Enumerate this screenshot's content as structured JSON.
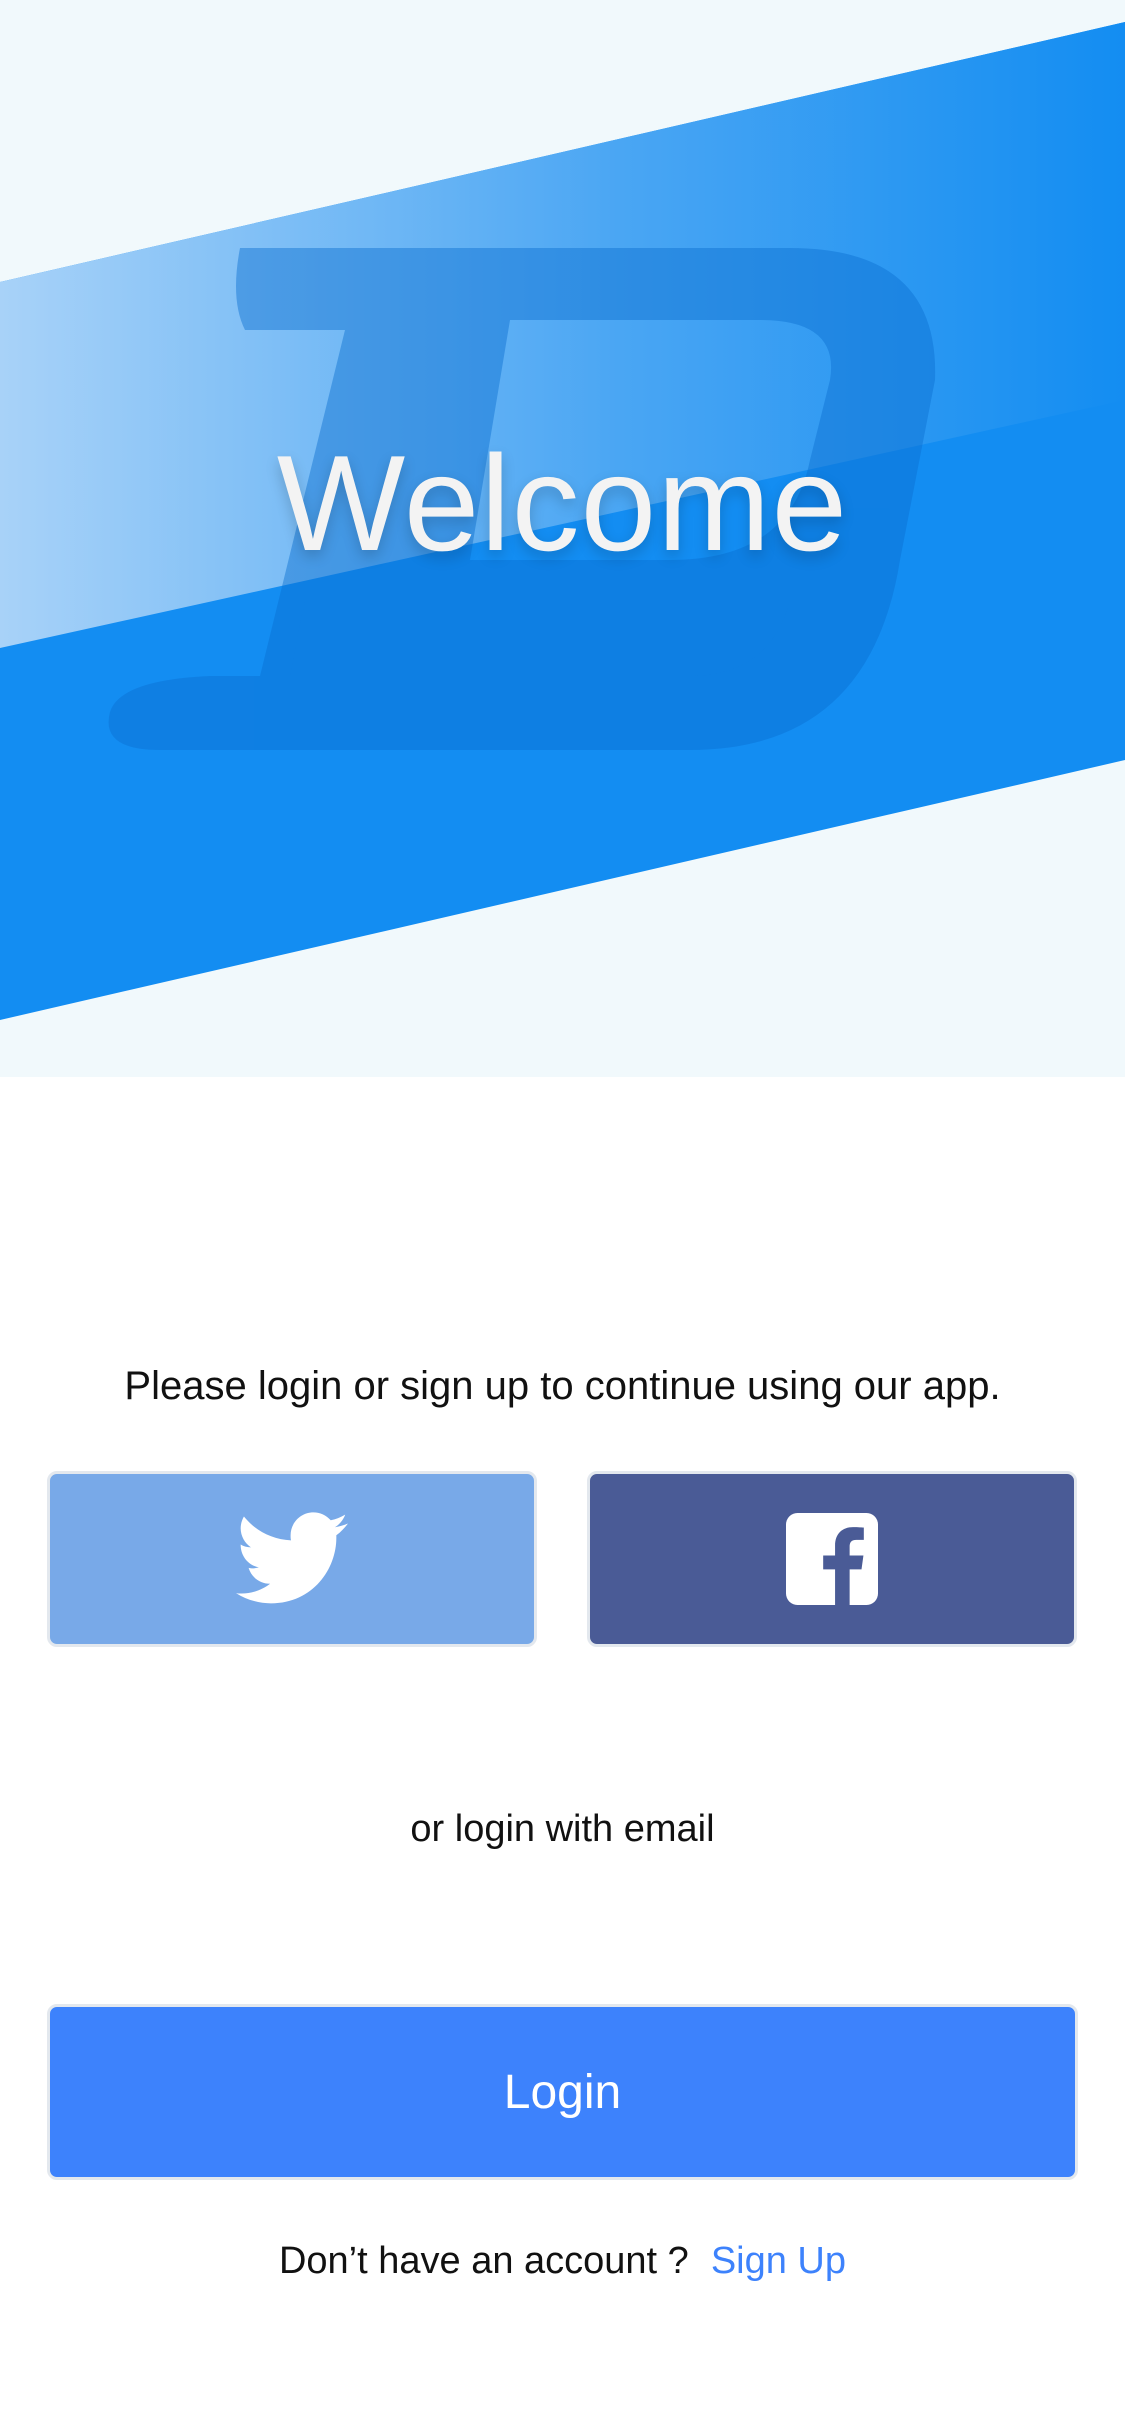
{
  "hero": {
    "title": "Welcome",
    "colors": {
      "background": "#f1f9fc",
      "band": "#138df2",
      "band_light": "#a8d2f8",
      "logo_tint": "#0a6fd1"
    }
  },
  "content": {
    "tagline": "Please login or sign up to continue using our app.",
    "or_email": "or login with email"
  },
  "social": {
    "twitter": {
      "icon": "twitter-bird-icon",
      "color": "#78a9e8"
    },
    "facebook": {
      "icon": "facebook-icon",
      "color": "#4a5b96"
    }
  },
  "login": {
    "label": "Login",
    "color": "#3d82fc"
  },
  "signup": {
    "question": "Don’t have an account ?",
    "link_label": "Sign Up"
  }
}
